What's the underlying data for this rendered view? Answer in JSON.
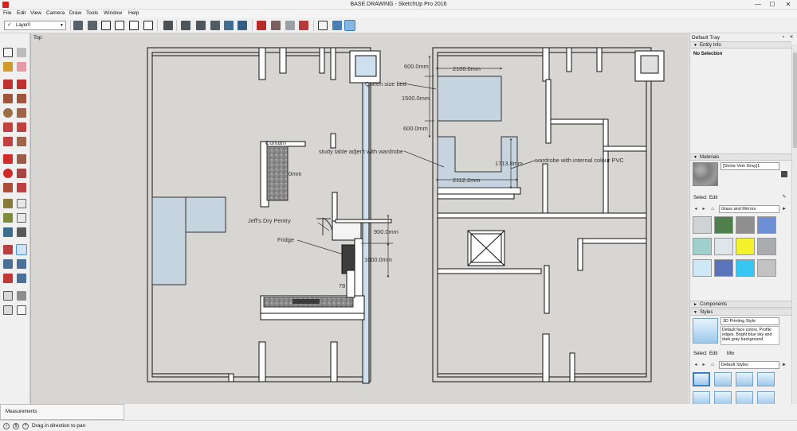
{
  "window": {
    "title": "BASE DRAWING - SketchUp Pro 2016",
    "min_glyph": "—",
    "max_glyph": "☐",
    "close_glyph": "✕"
  },
  "menu": [
    "File",
    "Edit",
    "View",
    "Camera",
    "Draw",
    "Tools",
    "Window",
    "Help"
  ],
  "toolbar": {
    "layer_check": "✓",
    "layer_value": "Layer0",
    "dropdown_glyph": "▼",
    "icons": [
      "make-component-icon",
      "component-icon",
      "house-icon",
      "house-outline-icon",
      "house-gable-icon",
      "house-3d-icon",
      "section-plane-icon",
      "display-section-icon",
      "display-cuts-icon",
      "xray-icon",
      "wireframe-icon",
      "hidden-line-icon",
      "shaded-icon",
      "textured-icon",
      "monochrome-icon",
      "view-iso-icon",
      "view-top-icon",
      "view-front-icon"
    ]
  },
  "scene": {
    "label": "Top"
  },
  "drawing": {
    "dims": {
      "d600a": "600.0mm",
      "d2100": "2100.0mm",
      "d1500": "1500.0mm",
      "d600b": "600.0mm",
      "d2112": "2112.2mm",
      "d1713": "1713.8mm",
      "d900": "900.0mm",
      "d1000": "1000.0mm",
      "dpartial": "0mm",
      "d78": "78"
    },
    "labels": {
      "queen_bed": "Queen size bed",
      "study_table": "study table adjent with wardrobe",
      "wardrobe": "wardrobe with internal colour PVC",
      "dry_pantry": "Jeff's Dry Pentry",
      "fridge": "Fridge",
      "counter_top": "Cuntam"
    }
  },
  "tray": {
    "title": "Default Tray",
    "pin_glyph": "▪",
    "close_glyph": "✕",
    "collapse_glyph": "▼",
    "expand_glyph": "►",
    "entity_info": {
      "header": "Entity Info",
      "value": "No Selection"
    },
    "materials": {
      "header": "Materials",
      "name": "[Stone Vein Gray]1",
      "tabs": [
        "Select",
        "Edit"
      ],
      "library": "Glass and Mirrors",
      "nav_back": "◂",
      "nav_forward": "▸",
      "home_glyph": "⌂",
      "details_glyph": "►",
      "sample_glyph": "✎",
      "swatch_colors": [
        "#cfd3d6",
        "#4f7f4a",
        "#8f8f8f",
        "#6d8fd6",
        "#9fd0cc",
        "#dfe5e8",
        "#f4f22c",
        "#a9adb0",
        "#cfe8f6",
        "#5b73b8",
        "#35c7f2",
        "#c2c2c2"
      ]
    },
    "components": {
      "header": "Components"
    },
    "styles": {
      "header": "Styles",
      "name": "3D Printing Style",
      "description": "Default face colors. Profile edges. Bright blue sky and dark gray background.",
      "tabs": [
        "Select",
        "Edit",
        "Mix"
      ],
      "library": "Default Styles"
    }
  },
  "measurements": {
    "label": "Measurements"
  },
  "status": {
    "text": "Drag in direction to pan",
    "icon1": "i",
    "icon2": "$",
    "icon3": "?"
  }
}
